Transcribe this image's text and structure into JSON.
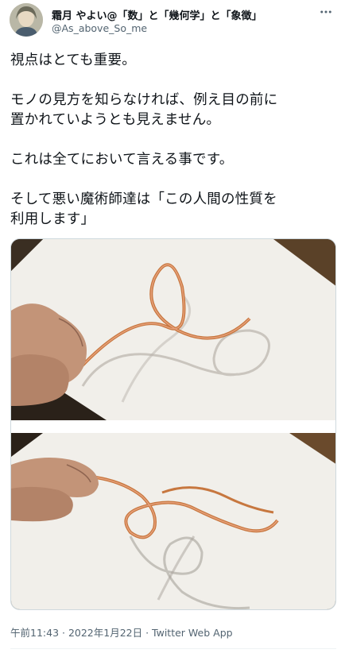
{
  "author": {
    "display_name": "霜月 やよい@「数」と「幾何学」と「象徴」",
    "handle": "@As_above_So_me"
  },
  "tweet": {
    "lines": [
      "視点はとても重要。",
      "",
      "モノの見方を知らなければ、例え目の前に",
      "置かれていようとも見えません。",
      "",
      "これは全てにおいて言える事です。",
      "",
      "そして悪い魔術師達は「この人間の性質を",
      "利用します」"
    ]
  },
  "meta": {
    "time": "午前11:43",
    "separator": " · ",
    "date": "2022年1月22日",
    "source": "Twitter Web App"
  },
  "icons": {
    "more": "more-horizontal-icon"
  },
  "colors": {
    "text": "#0f1419",
    "secondary": "#536471",
    "border": "#cfd9de"
  }
}
